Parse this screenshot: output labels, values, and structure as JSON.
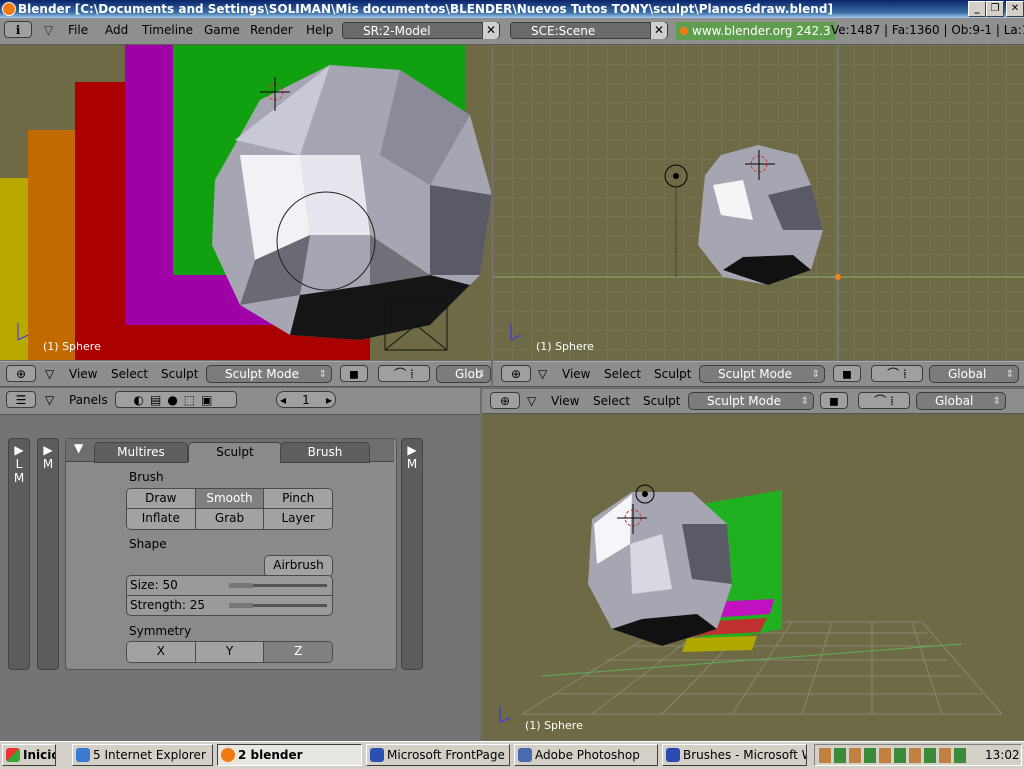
{
  "window": {
    "title": "Blender [C:\\Documents and Settings\\SOLIMAN\\Mis documentos\\BLENDER\\Nuevos Tutos TONY\\sculpt\\Planos6draw.blend]",
    "min": "_",
    "max": "❐",
    "close": "✕"
  },
  "header": {
    "menus": [
      "File",
      "Add",
      "Timeline",
      "Game",
      "Render",
      "Help"
    ],
    "screen": "SR:2-Model",
    "scene": "SCE:Scene",
    "url": "www.blender.org 242.3",
    "stats": "Ve:1487 | Fa:1360 | Ob:9-1 | La:1"
  },
  "viewports": {
    "caption": "(1) Sphere",
    "menus": [
      "View",
      "Select",
      "Sculpt"
    ],
    "mode": "Sculpt Mode",
    "orientation": "Global",
    "orientation_short": "Glob"
  },
  "buttons_window": {
    "panels_label": "Panels",
    "page": "1",
    "tabs": [
      "Multires",
      "Sculpt",
      "Brush"
    ],
    "brush_label": "Brush",
    "brushes": [
      "Draw",
      "Smooth",
      "Pinch",
      "Inflate",
      "Grab",
      "Layer"
    ],
    "active_brush": "Smooth",
    "shape_label": "Shape",
    "airbrush": "Airbrush",
    "size": "Size: 50",
    "size_value": 50,
    "strength": "Strength: 25",
    "strength_value": 25,
    "symmetry_label": "Symmetry",
    "symmetry": [
      "X",
      "Y",
      "Z"
    ],
    "sidebar_left": [
      "L",
      "M"
    ],
    "sidebar_mid": "M",
    "sidebar_right": "M"
  },
  "taskbar": {
    "start": "Inicio",
    "items": [
      "5 Internet Explorer",
      "2 blender",
      "Microsoft FrontPage -...",
      "Adobe Photoshop",
      "Brushes - Microsoft W..."
    ],
    "clock": "13:02"
  }
}
